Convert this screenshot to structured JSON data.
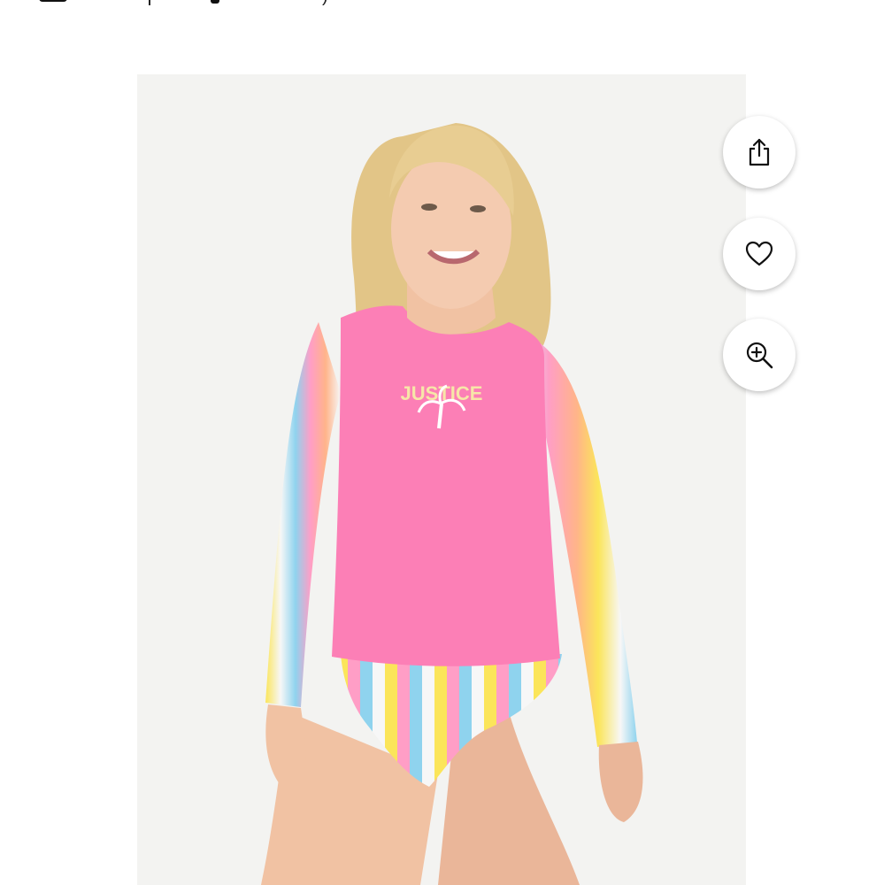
{
  "header": {
    "cart_icon": "cart-icon",
    "closing_paren": ")"
  },
  "product_image": {
    "logo_text": "JUSTICE",
    "background": "#f3f3f1",
    "shirt_color": "#fc7fb6",
    "stripe_colors": [
      "#ff9ec6",
      "#8fd3ee",
      "#fbe55a",
      "#ffb48a",
      "#f7f7f7"
    ]
  },
  "actions": {
    "share_icon": "share-icon",
    "favorite_icon": "heart-icon",
    "zoom_icon": "zoom-in-icon"
  }
}
